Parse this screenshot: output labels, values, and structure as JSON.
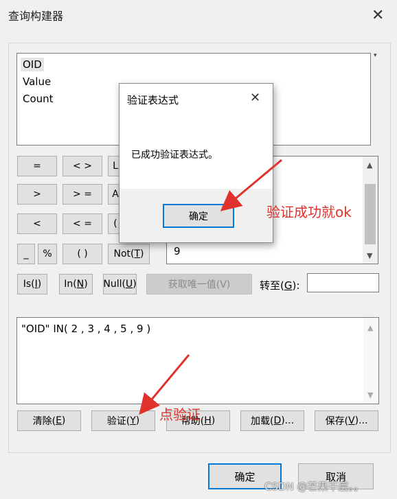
{
  "window": {
    "title": "查询构建器",
    "close_glyph": "✕"
  },
  "fields": {
    "items": [
      "OID",
      "Value",
      "Count"
    ],
    "selected": "OID"
  },
  "operators": {
    "row1": [
      "=",
      "< >",
      "L"
    ],
    "row2": [
      ">",
      "> =",
      "A"
    ],
    "row3": [
      "<",
      "< =",
      "("
    ],
    "row4": [
      "_",
      "%",
      "( )"
    ],
    "not_label": "Not(",
    "not_key": "T",
    "not_close": ")"
  },
  "values_list": {
    "items": [
      "9"
    ]
  },
  "functions": {
    "is_label": "Is(",
    "is_key": "I",
    "is_close": ")",
    "in_label": "In(",
    "in_key": "N",
    "in_close": ")",
    "null_label": "Null(",
    "null_key": "U",
    "null_close": ")"
  },
  "get_unique": "获取唯一值(V)",
  "goto": {
    "label": "转至(",
    "key": "G",
    "close": "):",
    "value": ""
  },
  "expression": "\"OID\" IN( 2 , 3 , 4 , 5 , 9 )",
  "bottom_buttons": {
    "clear": "清除(",
    "clear_key": "E",
    "clear_close": ")",
    "verify": "验证(",
    "verify_key": "Y",
    "verify_close": ")",
    "help": "帮助(",
    "help_key": "H",
    "help_close": ")",
    "load": "加载(",
    "load_key": "D",
    "load_close": ")...",
    "save": "保存(",
    "save_key": "V",
    "save_close": ")..."
  },
  "footer": {
    "ok": "确定",
    "cancel": "取消"
  },
  "dialog": {
    "title": "验证表达式",
    "message": "已成功验证表达式。",
    "ok": "确定",
    "close_glyph": "✕"
  },
  "annotations": {
    "success_note": "验证成功就ok",
    "click_note": "点验证",
    "color": "#e0322c"
  },
  "watermark": "CSDN @芒果干层。。"
}
